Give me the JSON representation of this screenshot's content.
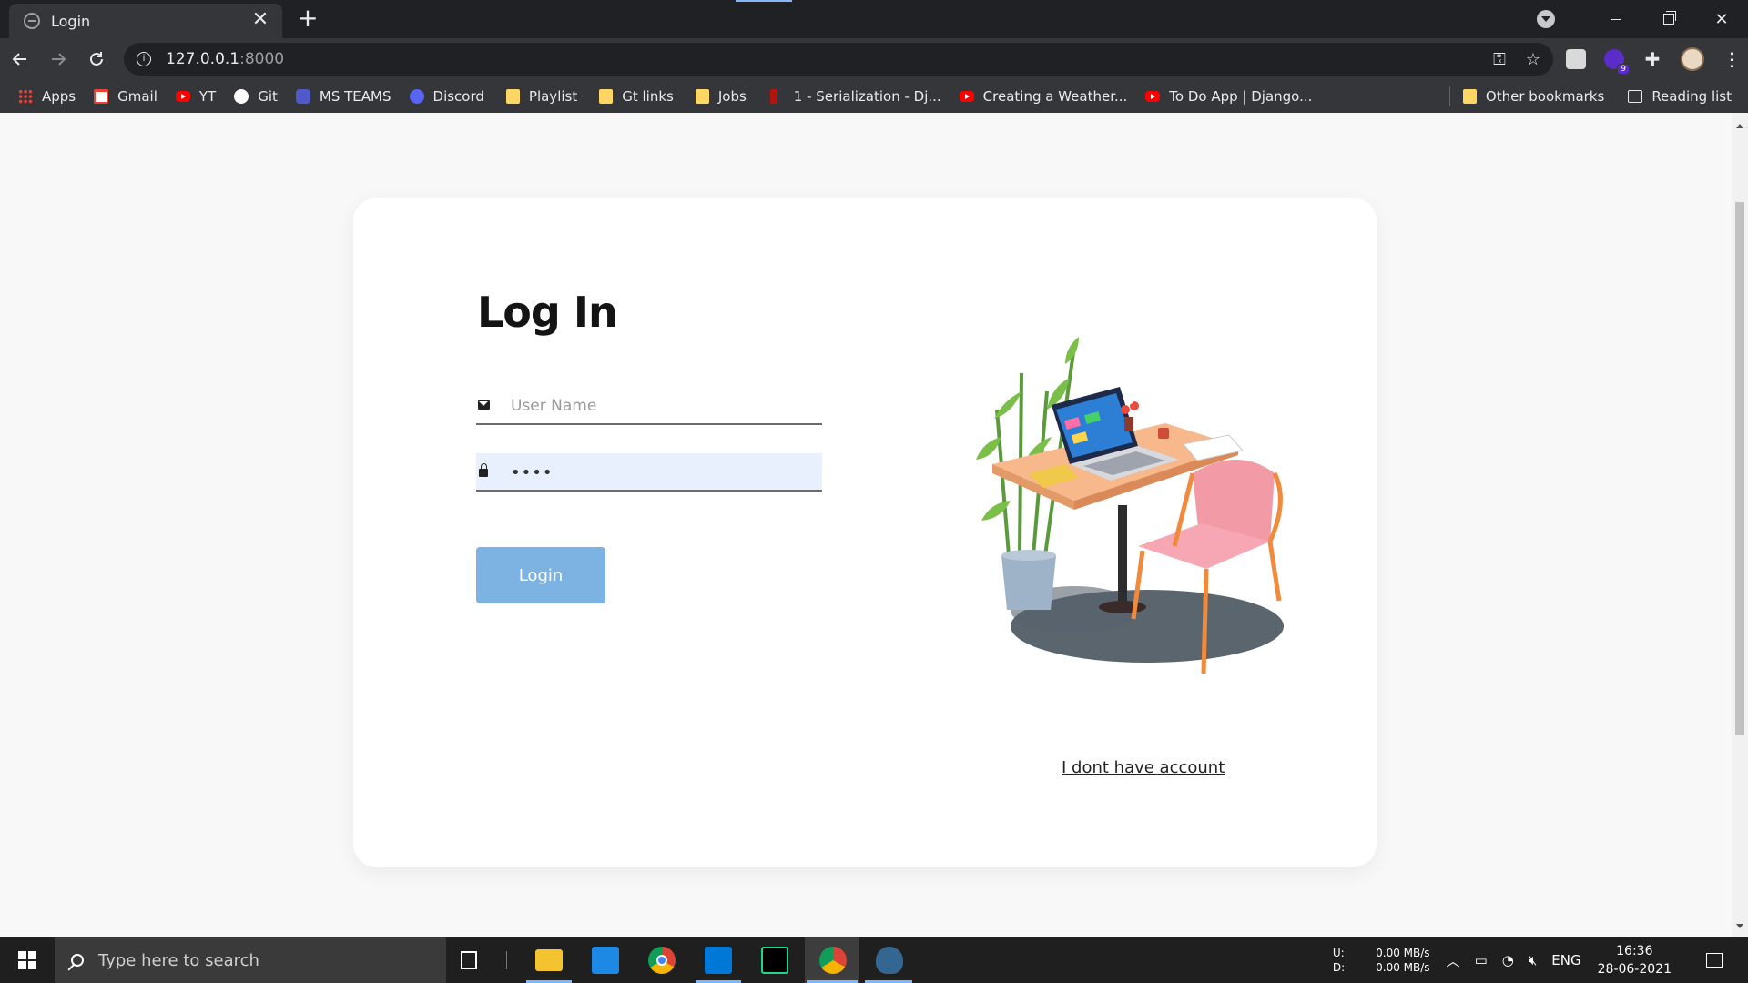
{
  "browser": {
    "tab_title": "Login",
    "new_tab": "+",
    "close_tab": "✕",
    "url_host": "127.0.0.1",
    "url_port": ":8000",
    "extension_badge": "9"
  },
  "bookmarks": {
    "items": [
      {
        "label": "Apps",
        "icon": "apps-grid-icon"
      },
      {
        "label": "Gmail",
        "icon": "gmail-icon"
      },
      {
        "label": "YT",
        "icon": "youtube-icon"
      },
      {
        "label": "Git",
        "icon": "github-icon"
      },
      {
        "label": "MS TEAMS",
        "icon": "teams-icon"
      },
      {
        "label": "Discord",
        "icon": "discord-icon"
      },
      {
        "label": "Playlist",
        "icon": "folder-icon"
      },
      {
        "label": "Gt links",
        "icon": "folder-icon"
      },
      {
        "label": "Jobs",
        "icon": "folder-icon"
      },
      {
        "label": "1 - Serialization - Dj...",
        "icon": "bookmark-red-icon"
      },
      {
        "label": "Creating a Weather...",
        "icon": "youtube-icon"
      },
      {
        "label": "To Do App | Django...",
        "icon": "youtube-icon"
      }
    ],
    "other": "Other bookmarks",
    "reading": "Reading list"
  },
  "login": {
    "title": "Log In",
    "username_placeholder": "User Name",
    "username_value": "",
    "password_value": "••••",
    "button": "Login",
    "no_account_link": "I dont have account"
  },
  "taskbar": {
    "search_placeholder": "Type here to search",
    "net_up_label": "U:",
    "net_down_label": "D:",
    "net_up": "0.00 MB/s",
    "net_down": "0.00 MB/s",
    "language": "ENG",
    "time": "16:36",
    "date": "28-06-2021"
  },
  "colors": {
    "accent_button": "#7db3e3",
    "autofill_bg": "#e8f0fe",
    "chrome_dark": "#35363a"
  }
}
